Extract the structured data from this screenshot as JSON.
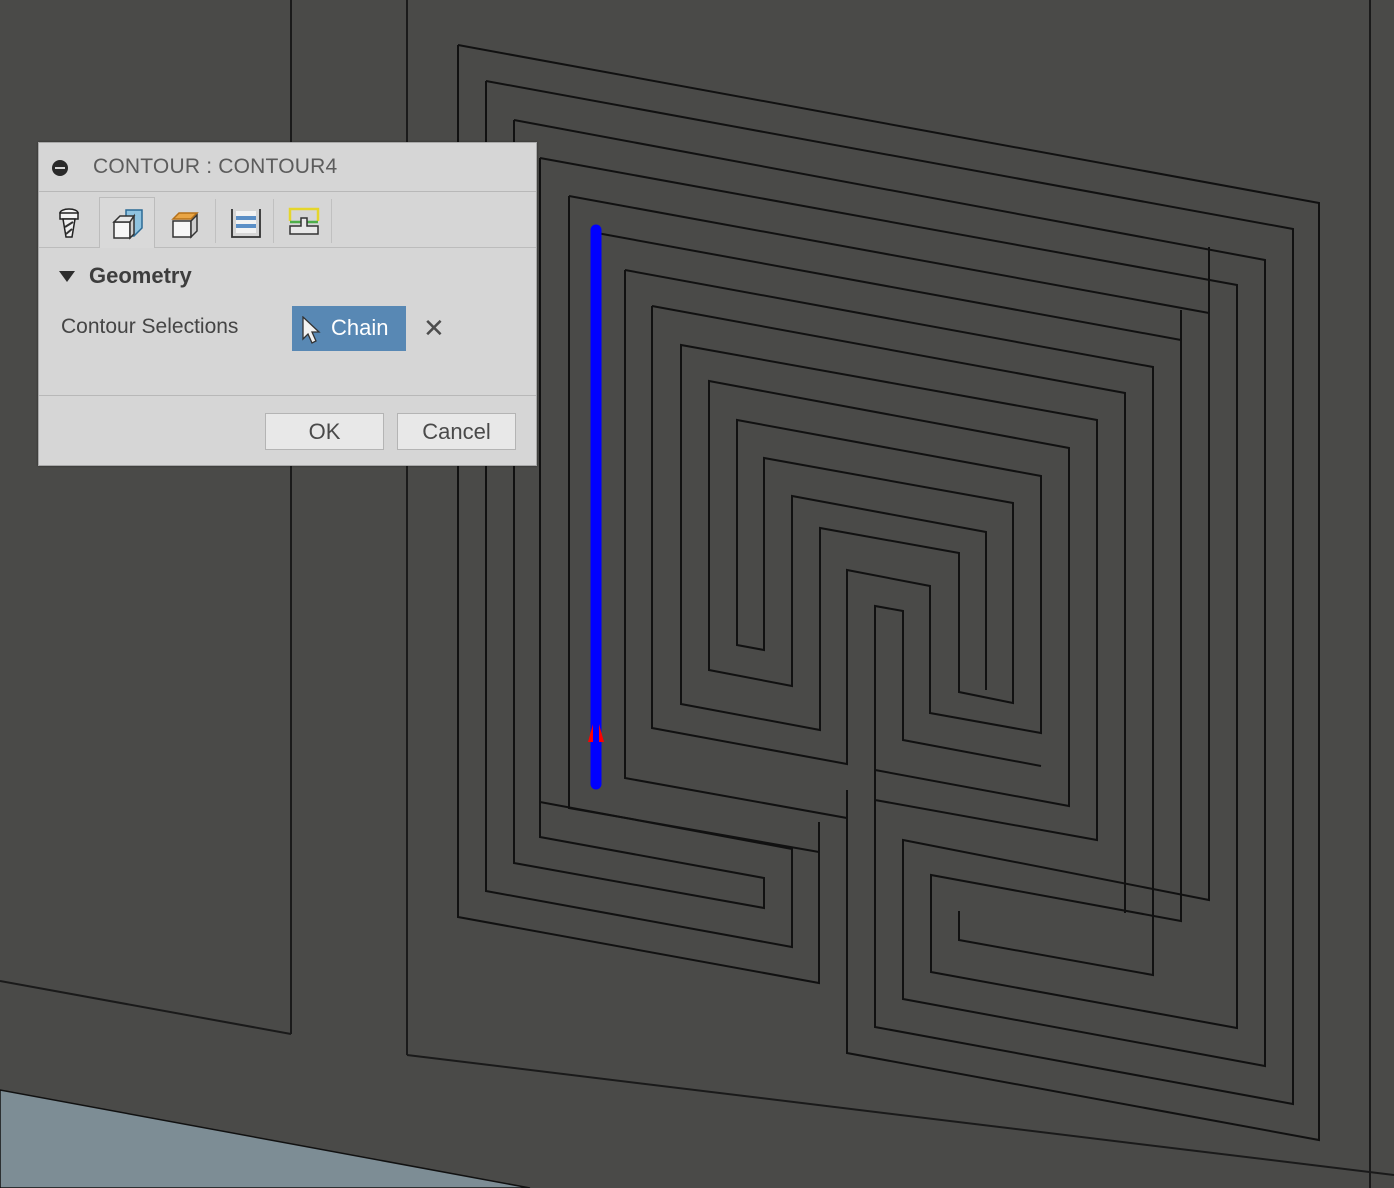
{
  "dialog": {
    "title": "CONTOUR : CONTOUR4",
    "tabs": [
      {
        "name": "tool",
        "icon": "drill-bit-icon",
        "active": false
      },
      {
        "name": "geometry",
        "icon": "geometry-box-icon",
        "active": true
      },
      {
        "name": "heights",
        "icon": "heights-box-icon",
        "active": false
      },
      {
        "name": "passes",
        "icon": "passes-icon",
        "active": false
      },
      {
        "name": "linking",
        "icon": "linking-icon",
        "active": false
      }
    ],
    "section": {
      "title": "Geometry",
      "expanded": true
    },
    "contour_selections": {
      "label": "Contour Selections",
      "button_label": "Chain",
      "clear_symbol": "✕"
    },
    "footer": {
      "ok_label": "OK",
      "cancel_label": "Cancel"
    }
  },
  "viewport": {
    "background_color": "#4a4a48",
    "ground_color": "#7d8d95",
    "edge_color": "#111111",
    "selection_color": "#0000ff",
    "direction_arrow_color": "#ff0000"
  }
}
